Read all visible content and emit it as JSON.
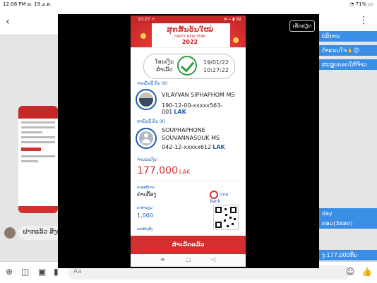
{
  "device_status": {
    "time": "12:08 PM",
    "date": "ພ. 19 ມ.ຄ.",
    "battery": "71%"
  },
  "chat": {
    "bubbles_right": [
      "ບໍລິການ",
      "ດຳແນນໃຈ🙏😊",
      "ສະຫຼຸບຍອດໃຫ້ຈ້າວ",
      "day",
      "ຄອມ(3ຂອດ)",
      "ງ:177.000ກີບ"
    ],
    "bubble_left": "ຝາກແລ້ວ ສິງບໍ່ເ",
    "compose_placeholder": "Aa"
  },
  "viewer": {
    "action_label": "ເຮັດຮຽດ"
  },
  "receipt": {
    "phone_time": "10:27 ↗",
    "phone_status_right": "✉ ⌁ ▮ 92",
    "banner_title": "ສຸກສັນວັນໃໝ່",
    "banner_subtitle": "HAPPY NEW YEAR",
    "banner_year": "2022",
    "status_text": "ໂອນເງິນ ສຳເລັດ",
    "date": "19/01/22",
    "time": "10:27:22",
    "from_label": "ຈາກບັນຊີ ຄົນ (₭)",
    "from_name": "VILAYVAN SIPHAPHOM MS",
    "from_account": "190-12-00-xxxxx563-001",
    "from_currency": "LAK",
    "to_label": "ຫາບັນຊີ ຄົນ (₭)",
    "to_name": "SOUPHAPHONE SOUVANNASOUK MS",
    "to_account": "042-12-xxxxx612",
    "to_currency": "LAK",
    "amount_label": "ຈຳນວນເງິນ",
    "amount": "177,000",
    "amount_currency": "LAK",
    "desc_label": "ຄຳອະທິບາຍ",
    "desc_value": "ຄ່າເຄື່ອງ",
    "fee_label": "ຄ່າທຳນຽມ",
    "fee_value": "1,000",
    "ref_label": "ເລກອ້າງອີງ",
    "logo_text": "One Bank",
    "done_button": "ສຳເລັດແລ້ວ",
    "nav_icons": [
      "≡",
      "□",
      "◁"
    ]
  },
  "colors": {
    "accent_red": "#d32f2f",
    "accent_blue": "#1e5bb8",
    "success_green": "#2e9e3e",
    "messenger_blue": "#3b8ee6"
  }
}
